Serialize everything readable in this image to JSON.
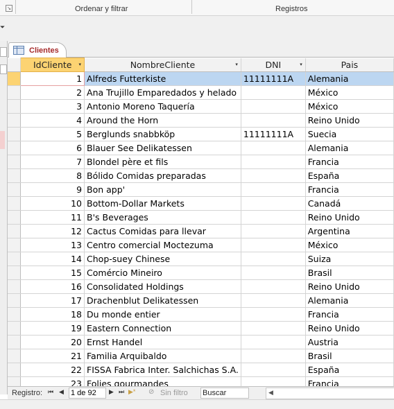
{
  "ribbon": {
    "group1_label": "Ordenar y filtrar",
    "group2_label": "Registros",
    "launcher_glyph": "↘",
    "collapse_glyph": "⏷"
  },
  "tab": {
    "label": "Clientes"
  },
  "columns": [
    {
      "label": "IdCliente",
      "sort_glyph": "▾"
    },
    {
      "label": "NombreCliente",
      "sort_glyph": "▾"
    },
    {
      "label": "DNI",
      "sort_glyph": "▾"
    },
    {
      "label": "Pais",
      "sort_glyph": ""
    }
  ],
  "rows": [
    [
      "1",
      "Alfreds Futterkiste",
      "11111111A",
      "Alemania"
    ],
    [
      "2",
      "Ana Trujillo Emparedados y helado",
      "",
      "México"
    ],
    [
      "3",
      "Antonio Moreno Taquería",
      "",
      "México"
    ],
    [
      "4",
      "Around the Horn",
      "",
      "Reino Unido"
    ],
    [
      "5",
      "Berglunds snabbköp",
      "11111111A",
      "Suecia"
    ],
    [
      "6",
      "Blauer See Delikatessen",
      "",
      "Alemania"
    ],
    [
      "7",
      "Blondel père et fils",
      "",
      "Francia"
    ],
    [
      "8",
      "Bólido Comidas preparadas",
      "",
      "España"
    ],
    [
      "9",
      "Bon app'",
      "",
      "Francia"
    ],
    [
      "10",
      "Bottom-Dollar Markets",
      "",
      "Canadá"
    ],
    [
      "11",
      "B's Beverages",
      "",
      "Reino Unido"
    ],
    [
      "12",
      "Cactus Comidas para llevar",
      "",
      "Argentina"
    ],
    [
      "13",
      "Centro comercial Moctezuma",
      "",
      "México"
    ],
    [
      "14",
      "Chop-suey Chinese",
      "",
      "Suiza"
    ],
    [
      "15",
      "Comércio Mineiro",
      "",
      "Brasil"
    ],
    [
      "16",
      "Consolidated Holdings",
      "",
      "Reino Unido"
    ],
    [
      "17",
      "Drachenblut Delikatessen",
      "",
      "Alemania"
    ],
    [
      "18",
      "Du monde entier",
      "",
      "Francia"
    ],
    [
      "19",
      "Eastern Connection",
      "",
      "Reino Unido"
    ],
    [
      "20",
      "Ernst Handel",
      "",
      "Austria"
    ],
    [
      "21",
      "Familia Arquibaldo",
      "",
      "Brasil"
    ],
    [
      "22",
      "FISSA Fabrica Inter. Salchichas S.A.",
      "",
      "España"
    ],
    [
      "23",
      "Folies gourmandes",
      "",
      "Francia"
    ]
  ],
  "current_row_index": 0,
  "navbar": {
    "label": "Registro:",
    "first_glyph": "⏮",
    "prev_glyph": "◀",
    "position": "1 de 92",
    "next_glyph": "▶",
    "last_glyph": "⏭",
    "new_glyph": "▶*",
    "filter_label": "Sin filtro",
    "filter_glyph": "⊘",
    "search_text": "Buscar",
    "scroll_left_glyph": "◀"
  },
  "colors": {
    "selected_header": "#fcd372",
    "current_row": "#bcd6f1",
    "tab_text": "#a52a2a"
  }
}
